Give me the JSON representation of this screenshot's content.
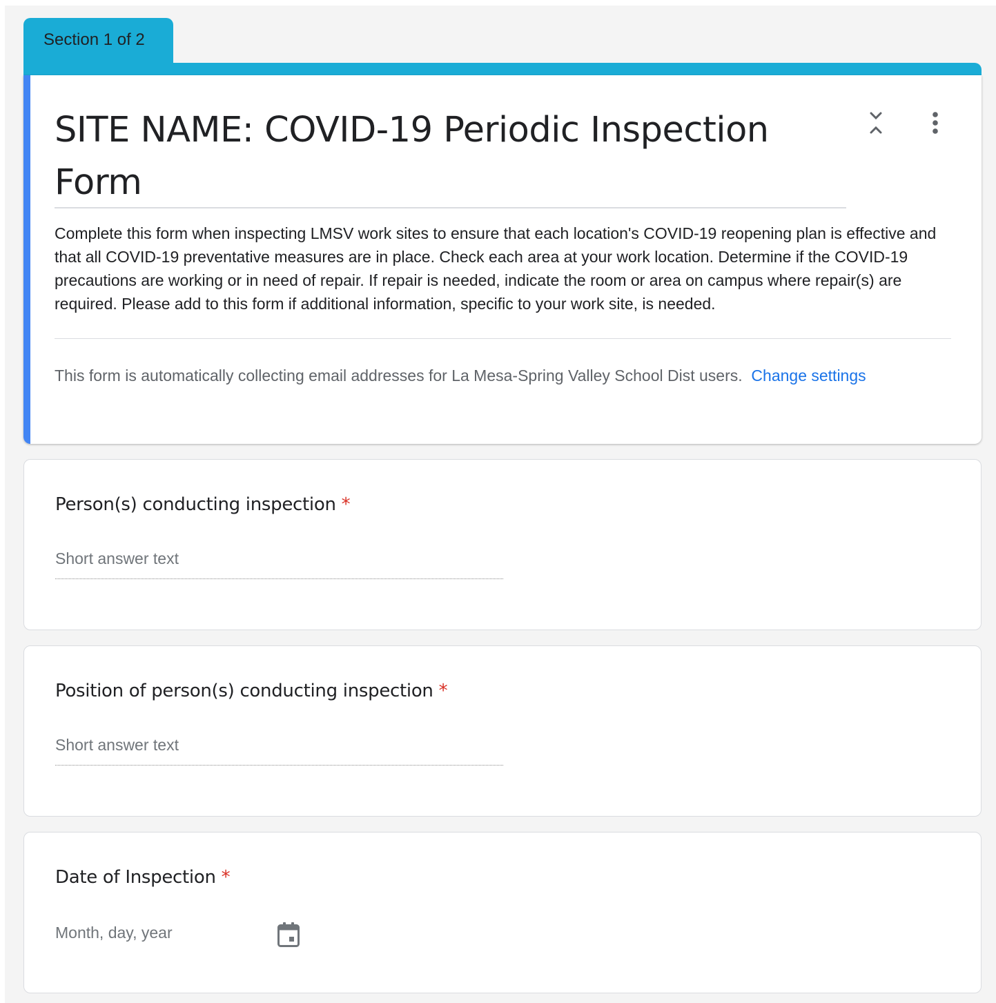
{
  "section": {
    "label": "Section 1 of 2",
    "color": "#1aacd6"
  },
  "header": {
    "title": "SITE NAME: COVID-19 Periodic Inspection Form",
    "description": "Complete this form when inspecting LMSV work sites to ensure that each location's COVID-19 reopening plan is effective and that all COVID-19 preventative measures are in place. Check each area at your work location. Determine if the COVID-19 precautions are working or in need of repair. If repair is needed, indicate the room or area on campus where repair(s) are required. Please add to this form if additional information, specific to your work site, is needed.",
    "email_notice": "This form is automatically collecting email addresses for La Mesa-Spring Valley School Dist users.",
    "change_settings_link": "Change settings",
    "accent_color": "#4285f4",
    "link_color": "#1a73e8",
    "icons": {
      "collapse": "collapse-icon",
      "more": "more-vert-icon"
    }
  },
  "questions": [
    {
      "title": "Person(s) conducting inspection",
      "required_mark": "*",
      "type": "short_answer",
      "placeholder": "Short answer text"
    },
    {
      "title": "Position of person(s) conducting inspection",
      "required_mark": "*",
      "type": "short_answer",
      "placeholder": "Short answer text"
    },
    {
      "title": "Date of Inspection",
      "required_mark": "*",
      "type": "date",
      "placeholder": "Month, day, year",
      "icon": "calendar-icon"
    }
  ],
  "colors": {
    "required": "#d93025",
    "background": "#f4f4f4"
  }
}
